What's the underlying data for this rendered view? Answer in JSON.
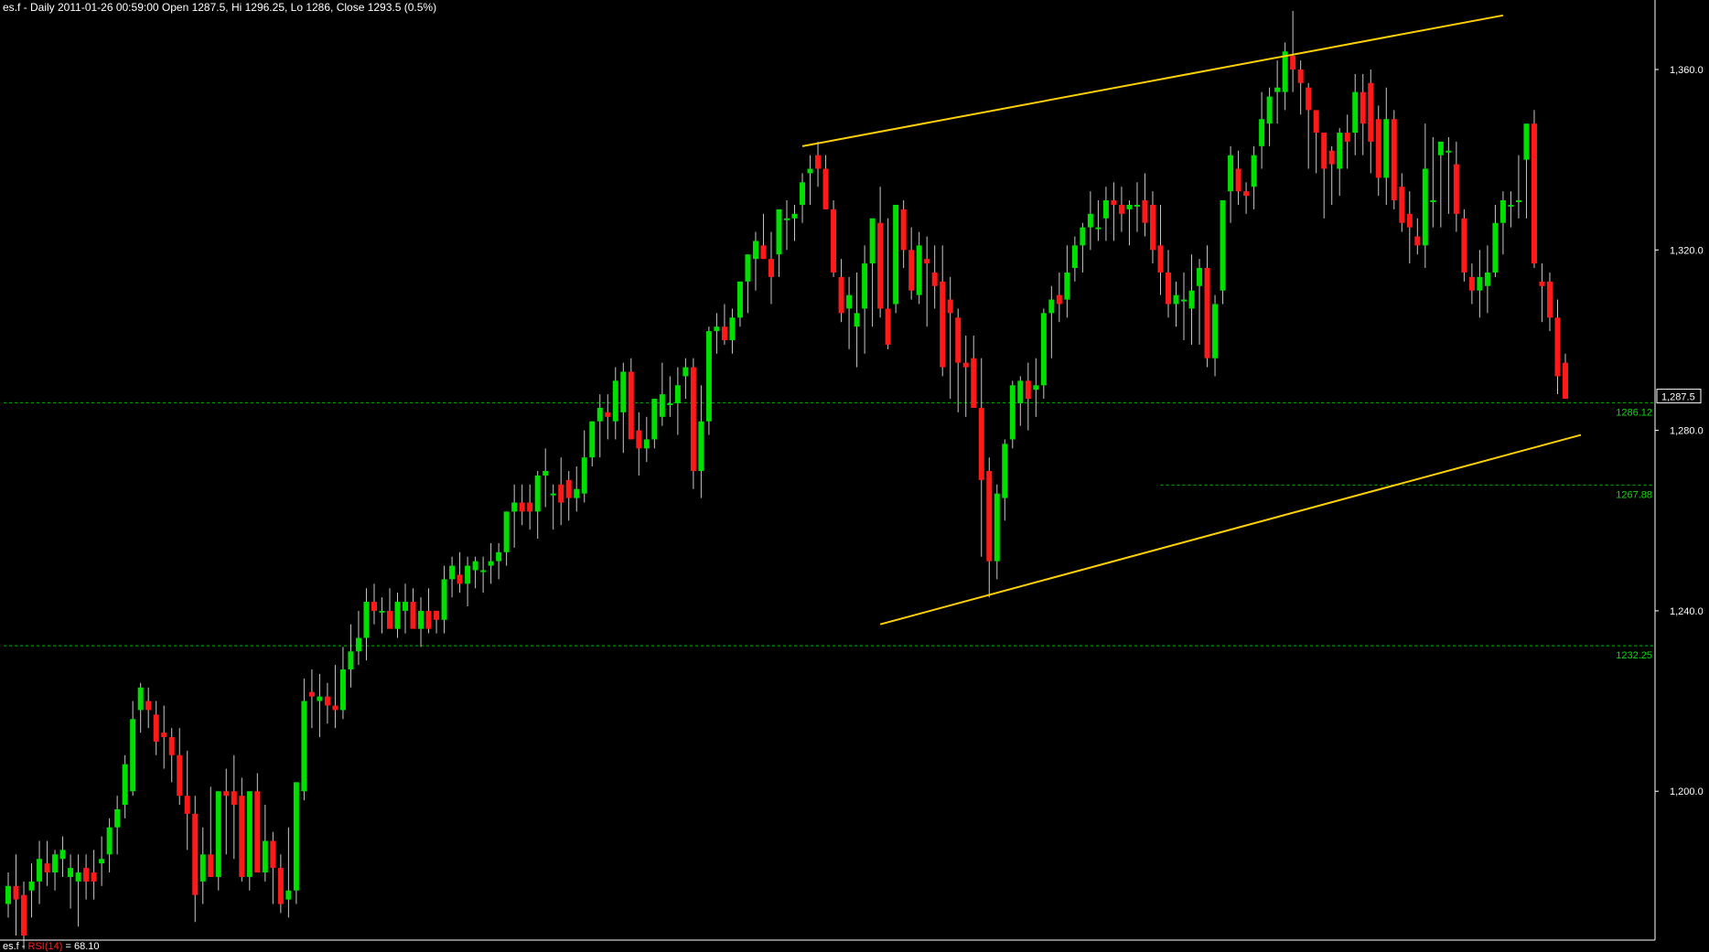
{
  "header": {
    "text": "es.f - Daily 2011-01-26 00:59:00 Open 1287.5, Hi 1296.25, Lo 1286, Close 1293.5 (0.5%)"
  },
  "footer": {
    "symbol": "es.f - ",
    "indicator": "RSI(14)",
    "value": " = 68.10"
  },
  "colors": {
    "background": "#000000",
    "up": "#00e000",
    "down": "#ff1a1a",
    "wick": "#c8c8c8",
    "trendline": "#ffd000",
    "hline": "#00b400",
    "axis": "#ffffff",
    "axis_label": "#ffffff",
    "hline_label": "#00e000"
  },
  "chart_data": {
    "type": "candlestick",
    "y_range": [
      1167,
      1375
    ],
    "y_ticks": [
      {
        "value": 1360,
        "label": "1,360.0"
      },
      {
        "value": 1320,
        "label": "1,320.0"
      },
      {
        "value": 1280,
        "label": "1,280.0"
      },
      {
        "value": 1240,
        "label": "1,240.0"
      },
      {
        "value": 1200,
        "label": "1,200.0"
      }
    ],
    "last_price": {
      "value": 1287.5,
      "label": "1,287.5"
    },
    "hlines": [
      {
        "value": 1286.12,
        "label": "1286.12",
        "x_from": 0
      },
      {
        "value": 1267.88,
        "label": "1267.88",
        "x_from": 148
      },
      {
        "value": 1232.25,
        "label": "1232.25",
        "x_from": 0
      }
    ],
    "trendlines": [
      {
        "x1": 102,
        "y1": 1343,
        "x2": 192,
        "y2": 1372
      },
      {
        "x1": 112,
        "y1": 1237,
        "x2": 202,
        "y2": 1279
      }
    ],
    "candles": [
      [
        1175,
        1182,
        1172,
        1179
      ],
      [
        1179,
        1186,
        1168,
        1176
      ],
      [
        1177,
        1180,
        1165,
        1168
      ],
      [
        1178,
        1184,
        1172,
        1180
      ],
      [
        1180,
        1189,
        1175,
        1185
      ],
      [
        1184,
        1189,
        1179,
        1182
      ],
      [
        1182,
        1187,
        1178,
        1186
      ],
      [
        1185,
        1190,
        1181,
        1187
      ],
      [
        1181,
        1186,
        1174,
        1183
      ],
      [
        1180,
        1186,
        1170,
        1182
      ],
      [
        1183,
        1186,
        1176,
        1180
      ],
      [
        1182,
        1187,
        1176,
        1180
      ],
      [
        1184,
        1190,
        1179,
        1185
      ],
      [
        1186,
        1194,
        1182,
        1192
      ],
      [
        1192,
        1199,
        1186,
        1196
      ],
      [
        1197,
        1208,
        1194,
        1206
      ],
      [
        1200,
        1220,
        1199,
        1216
      ],
      [
        1218,
        1224,
        1213,
        1223
      ],
      [
        1220,
        1223,
        1214,
        1218
      ],
      [
        1217,
        1220,
        1208,
        1211
      ],
      [
        1213,
        1219,
        1205,
        1212
      ],
      [
        1212,
        1214,
        1202,
        1208
      ],
      [
        1208,
        1214,
        1197,
        1199
      ],
      [
        1199,
        1209,
        1187,
        1195
      ],
      [
        1195,
        1199,
        1171,
        1177
      ],
      [
        1180,
        1192,
        1175,
        1186
      ],
      [
        1186,
        1201,
        1181,
        1181
      ],
      [
        1181,
        1199,
        1178,
        1200
      ],
      [
        1200,
        1205,
        1186,
        1199
      ],
      [
        1200,
        1208,
        1185,
        1197
      ],
      [
        1199,
        1203,
        1180,
        1181
      ],
      [
        1181,
        1196,
        1178,
        1200
      ],
      [
        1200,
        1204,
        1184,
        1182
      ],
      [
        1182,
        1197,
        1180,
        1189
      ],
      [
        1189,
        1191,
        1175,
        1183
      ],
      [
        1183,
        1186,
        1173,
        1175
      ],
      [
        1176,
        1192,
        1172,
        1178
      ],
      [
        1178,
        1200,
        1175,
        1202
      ],
      [
        1200,
        1225,
        1198,
        1220
      ],
      [
        1222,
        1227,
        1214,
        1221
      ],
      [
        1220,
        1226,
        1212,
        1221
      ],
      [
        1221,
        1224,
        1215,
        1219
      ],
      [
        1219,
        1228,
        1214,
        1218
      ],
      [
        1218,
        1232,
        1216,
        1227
      ],
      [
        1227,
        1237,
        1223,
        1231
      ],
      [
        1231,
        1240,
        1228,
        1234
      ],
      [
        1234,
        1245,
        1229,
        1242
      ],
      [
        1242,
        1246,
        1237,
        1240
      ],
      [
        1240,
        1243,
        1235,
        1240
      ],
      [
        1240,
        1245,
        1237,
        1236
      ],
      [
        1236,
        1244,
        1234,
        1242
      ],
      [
        1240,
        1246,
        1235,
        1242
      ],
      [
        1242,
        1245,
        1237,
        1236
      ],
      [
        1236,
        1243,
        1232,
        1240
      ],
      [
        1240,
        1245,
        1235,
        1236
      ],
      [
        1240,
        1240,
        1235,
        1238
      ],
      [
        1238,
        1250,
        1235,
        1247
      ],
      [
        1247,
        1252,
        1243,
        1250
      ],
      [
        1248,
        1253,
        1244,
        1246
      ],
      [
        1246,
        1252,
        1241,
        1250
      ],
      [
        1249,
        1252,
        1245,
        1251
      ],
      [
        1249,
        1252,
        1244,
        1249
      ],
      [
        1250,
        1255,
        1246,
        1251
      ],
      [
        1251,
        1255,
        1247,
        1253
      ],
      [
        1253,
        1262,
        1250,
        1262
      ],
      [
        1262,
        1268,
        1254,
        1264
      ],
      [
        1264,
        1268,
        1259,
        1262
      ],
      [
        1264,
        1268,
        1258,
        1262
      ],
      [
        1262,
        1271,
        1256,
        1270
      ],
      [
        1270,
        1276,
        1263,
        1271
      ],
      [
        1266,
        1268,
        1258,
        1266
      ],
      [
        1268,
        1274,
        1259,
        1264
      ],
      [
        1269,
        1271,
        1260,
        1265
      ],
      [
        1265,
        1272,
        1262,
        1267
      ],
      [
        1266,
        1280,
        1264,
        1274
      ],
      [
        1274,
        1282,
        1272,
        1282
      ],
      [
        1282,
        1288,
        1274,
        1285
      ],
      [
        1284,
        1288,
        1278,
        1283
      ],
      [
        1282,
        1294,
        1278,
        1291
      ],
      [
        1284,
        1295,
        1275,
        1293
      ],
      [
        1293,
        1296,
        1279,
        1278
      ],
      [
        1280,
        1284,
        1270,
        1276
      ],
      [
        1276,
        1283,
        1273,
        1278
      ],
      [
        1278,
        1285,
        1276,
        1287
      ],
      [
        1283,
        1295,
        1281,
        1288
      ],
      [
        1286,
        1292,
        1283,
        1286
      ],
      [
        1286,
        1294,
        1279,
        1290
      ],
      [
        1292,
        1296,
        1287,
        1294
      ],
      [
        1294,
        1296,
        1267,
        1271
      ],
      [
        1271,
        1290,
        1265,
        1282
      ],
      [
        1282,
        1303,
        1279,
        1302
      ],
      [
        1302,
        1306,
        1297,
        1303
      ],
      [
        1303,
        1308,
        1299,
        1300
      ],
      [
        1300,
        1307,
        1297,
        1305
      ],
      [
        1305,
        1313,
        1303,
        1313
      ],
      [
        1313,
        1319,
        1306,
        1319
      ],
      [
        1318,
        1324,
        1311,
        1322
      ],
      [
        1321,
        1328,
        1318,
        1318
      ],
      [
        1318,
        1324,
        1308,
        1314
      ],
      [
        1319,
        1329,
        1314,
        1329
      ],
      [
        1327,
        1331,
        1320,
        1327
      ],
      [
        1327,
        1330,
        1322,
        1328
      ],
      [
        1330,
        1337,
        1326,
        1335
      ],
      [
        1337,
        1341,
        1330,
        1338
      ],
      [
        1341,
        1344,
        1334,
        1338
      ],
      [
        1338,
        1341,
        1329,
        1329
      ],
      [
        1329,
        1331,
        1314,
        1315
      ],
      [
        1314,
        1318,
        1304,
        1306
      ],
      [
        1307,
        1314,
        1298,
        1310
      ],
      [
        1303,
        1315,
        1294,
        1306
      ],
      [
        1307,
        1321,
        1297,
        1317
      ],
      [
        1317,
        1326,
        1303,
        1327
      ],
      [
        1326,
        1334,
        1305,
        1307
      ],
      [
        1307,
        1327,
        1298,
        1299
      ],
      [
        1308,
        1328,
        1306,
        1330
      ],
      [
        1329,
        1331,
        1316,
        1320
      ],
      [
        1320,
        1325,
        1309,
        1311
      ],
      [
        1310,
        1324,
        1308,
        1321
      ],
      [
        1318,
        1323,
        1303,
        1317
      ],
      [
        1315,
        1321,
        1307,
        1312
      ],
      [
        1313,
        1321,
        1292,
        1294
      ],
      [
        1309,
        1314,
        1287,
        1306
      ],
      [
        1305,
        1307,
        1284,
        1295
      ],
      [
        1295,
        1301,
        1283,
        1294
      ],
      [
        1296,
        1301,
        1285,
        1285
      ],
      [
        1285,
        1296,
        1252,
        1269
      ],
      [
        1271,
        1274,
        1243,
        1251
      ],
      [
        1251,
        1268,
        1247,
        1266
      ],
      [
        1265,
        1278,
        1260,
        1277
      ],
      [
        1278,
        1291,
        1276,
        1290
      ],
      [
        1286,
        1292,
        1281,
        1291
      ],
      [
        1291,
        1295,
        1280,
        1287
      ],
      [
        1289,
        1296,
        1283,
        1290
      ],
      [
        1290,
        1307,
        1287,
        1306
      ],
      [
        1306,
        1312,
        1296,
        1309
      ],
      [
        1310,
        1315,
        1304,
        1308
      ],
      [
        1309,
        1321,
        1305,
        1315
      ],
      [
        1316,
        1323,
        1313,
        1321
      ],
      [
        1321,
        1326,
        1315,
        1325
      ],
      [
        1325,
        1333,
        1320,
        1328
      ],
      [
        1325,
        1331,
        1322,
        1325
      ],
      [
        1327,
        1334,
        1322,
        1331
      ],
      [
        1331,
        1335,
        1322,
        1330
      ],
      [
        1330,
        1334,
        1324,
        1328
      ],
      [
        1329,
        1331,
        1321,
        1330
      ],
      [
        1330,
        1335,
        1324,
        1330
      ],
      [
        1331,
        1337,
        1323,
        1326
      ],
      [
        1330,
        1333,
        1317,
        1320
      ],
      [
        1321,
        1330,
        1310,
        1315
      ],
      [
        1315,
        1320,
        1305,
        1308
      ],
      [
        1308,
        1313,
        1303,
        1310
      ],
      [
        1309,
        1315,
        1300,
        1309
      ],
      [
        1307,
        1319,
        1299,
        1311
      ],
      [
        1312,
        1318,
        1299,
        1316
      ],
      [
        1316,
        1321,
        1294,
        1296
      ],
      [
        1296,
        1310,
        1292,
        1308
      ],
      [
        1311,
        1330,
        1308,
        1331
      ],
      [
        1333,
        1343,
        1326,
        1341
      ],
      [
        1338,
        1342,
        1330,
        1333
      ],
      [
        1333,
        1335,
        1328,
        1332
      ],
      [
        1334,
        1343,
        1329,
        1341
      ],
      [
        1343,
        1355,
        1338,
        1349
      ],
      [
        1348,
        1356,
        1343,
        1354
      ],
      [
        1355,
        1362,
        1348,
        1356
      ],
      [
        1355,
        1366,
        1351,
        1364
      ],
      [
        1363,
        1373,
        1355,
        1360
      ],
      [
        1360,
        1362,
        1350,
        1357
      ],
      [
        1356,
        1357,
        1338,
        1351
      ],
      [
        1351,
        1349,
        1337,
        1346
      ],
      [
        1346,
        1346,
        1327,
        1338
      ],
      [
        1342,
        1343,
        1330,
        1339
      ],
      [
        1338,
        1347,
        1332,
        1346
      ],
      [
        1346,
        1350,
        1338,
        1344
      ],
      [
        1346,
        1359,
        1341,
        1355
      ],
      [
        1355,
        1359,
        1341,
        1348
      ],
      [
        1357,
        1360,
        1337,
        1344
      ],
      [
        1349,
        1352,
        1332,
        1336
      ],
      [
        1336,
        1356,
        1330,
        1349
      ],
      [
        1349,
        1351,
        1329,
        1331
      ],
      [
        1334,
        1337,
        1324,
        1326
      ],
      [
        1328,
        1333,
        1317,
        1325
      ],
      [
        1323,
        1327,
        1319,
        1321
      ],
      [
        1321,
        1348,
        1316,
        1338
      ],
      [
        1331,
        1345,
        1325,
        1331
      ],
      [
        1341,
        1344,
        1325,
        1344
      ],
      [
        1342,
        1345,
        1328,
        1342
      ],
      [
        1339,
        1344,
        1324,
        1328
      ],
      [
        1327,
        1329,
        1313,
        1315
      ],
      [
        1314,
        1317,
        1308,
        1311
      ],
      [
        1311,
        1320,
        1305,
        1314
      ],
      [
        1312,
        1321,
        1306,
        1315
      ],
      [
        1315,
        1330,
        1314,
        1326
      ],
      [
        1326,
        1333,
        1319,
        1331
      ],
      [
        1330,
        1333,
        1325,
        1330
      ],
      [
        1331,
        1341,
        1327,
        1331
      ],
      [
        1340,
        1347,
        1327,
        1348
      ],
      [
        1348,
        1351,
        1316,
        1317
      ],
      [
        1313,
        1317,
        1304,
        1312
      ],
      [
        1313,
        1315,
        1302,
        1305
      ],
      [
        1305,
        1309,
        1288,
        1292
      ],
      [
        1295,
        1297,
        1288,
        1287
      ]
    ]
  }
}
